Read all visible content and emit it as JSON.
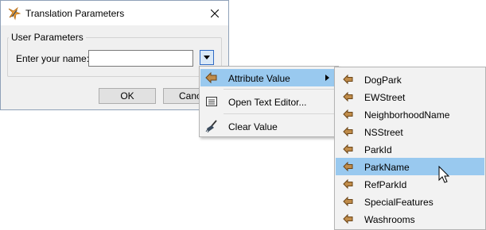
{
  "dialog": {
    "title": "Translation Parameters",
    "group_title": "User Parameters",
    "name_label": "Enter your name:",
    "name_value": "",
    "ok_label": "OK",
    "cancel_label": "Cancel"
  },
  "menu": {
    "items": [
      {
        "label": "Attribute Value",
        "icon": "attribute-icon",
        "has_submenu": true,
        "highlighted": true
      },
      {
        "label": "Open Text Editor...",
        "icon": "text-editor-icon"
      },
      {
        "label": "Clear Value",
        "icon": "broom-icon"
      }
    ]
  },
  "submenu": {
    "items": [
      {
        "label": "DogPark"
      },
      {
        "label": "EWStreet"
      },
      {
        "label": "NeighborhoodName"
      },
      {
        "label": "NSStreet"
      },
      {
        "label": "ParkId"
      },
      {
        "label": "ParkName",
        "highlighted": true
      },
      {
        "label": "RefParkId"
      },
      {
        "label": "SpecialFeatures"
      },
      {
        "label": "Washrooms"
      }
    ]
  },
  "colors": {
    "highlight": "#99c9ef",
    "attribute_icon": "#c08c4a",
    "dialog_bg": "#f0f0f0",
    "menu_bg": "#f2f2f2"
  }
}
